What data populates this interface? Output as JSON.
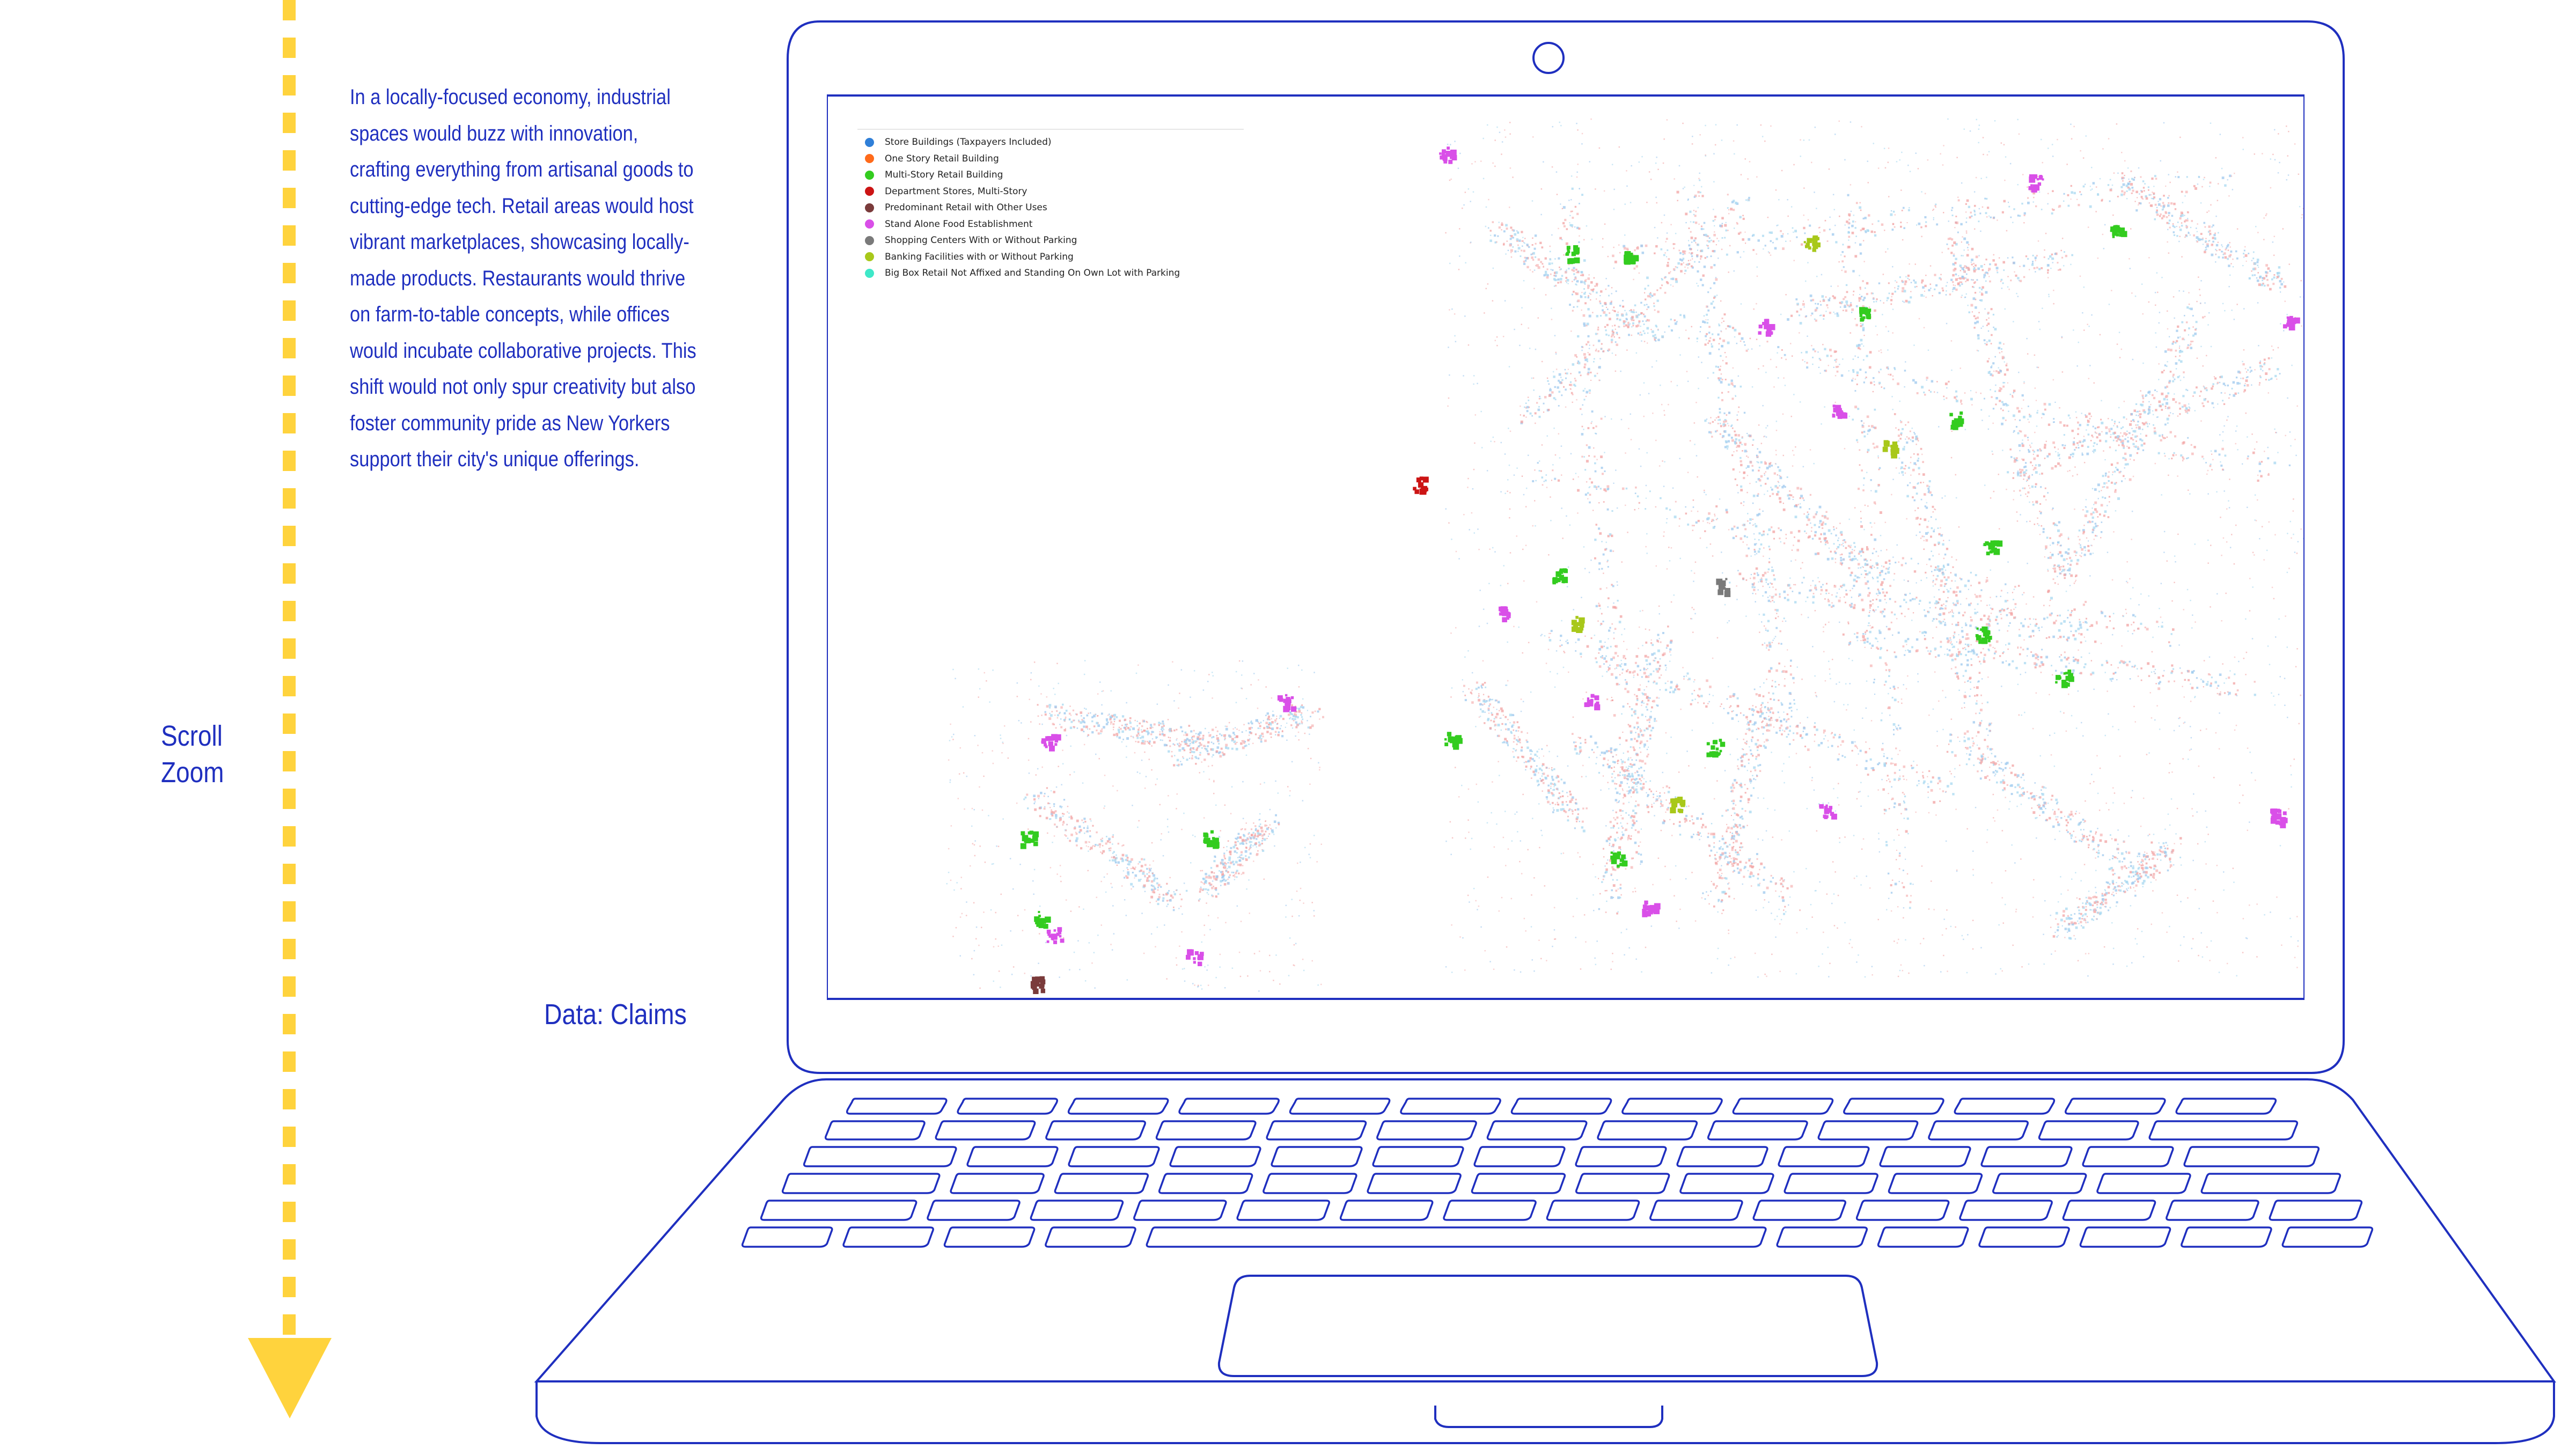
{
  "sidebar": {
    "scroll_label": "Scroll",
    "zoom_label": "Zoom",
    "story": "In a locally-focused economy, industrial spaces would buzz with innovation, crafting everything from artisanal goods to cutting-edge tech. Retail areas would host vibrant marketplaces, showcasing locally-made products. Restaurants would thrive on farm-to-table concepts, while offices would incubate collaborative projects. This shift would not only spur creativity but also foster community pride as New Yorkers support their city's unique offerings.",
    "data_label": "Data: Claims"
  },
  "colors": {
    "accent": "#1f2fbf",
    "scroll_guide": "#ffd33d"
  },
  "legend": {
    "items": [
      {
        "label": "Store Buildings (Taxpayers Included)",
        "color": "#2f7fd8"
      },
      {
        "label": "One Story Retail Building",
        "color": "#ff6a1a"
      },
      {
        "label": "Multi-Story Retail Building",
        "color": "#33cc1f"
      },
      {
        "label": "Department Stores, Multi-Story",
        "color": "#cc1414"
      },
      {
        "label": "Predominant Retail with Other Uses",
        "color": "#7a3b3b"
      },
      {
        "label": "Stand Alone Food Establishment",
        "color": "#d94fe8"
      },
      {
        "label": "Shopping Centers With or Without Parking",
        "color": "#7a7a7a"
      },
      {
        "label": "Banking Facilities with or Without Parking",
        "color": "#a8c81a"
      },
      {
        "label": "Big Box Retail Not Affixed and Standing On Own Lot with Parking",
        "color": "#3ee8c8"
      }
    ]
  },
  "map": {
    "type": "scatter",
    "seed": 7,
    "base_colors": [
      "#f2a3a3",
      "#a8d8f0",
      "#9ec8ee",
      "#f5b8b8"
    ]
  }
}
